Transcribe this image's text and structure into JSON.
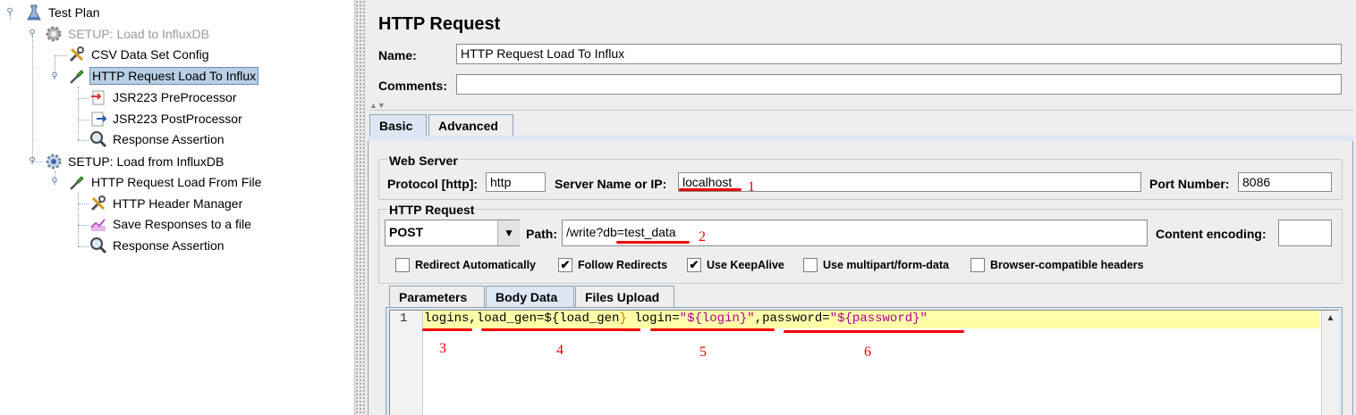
{
  "tree": {
    "items": [
      {
        "label": "Test Plan",
        "icon": "flask-icon",
        "disabled": false
      },
      {
        "label": "SETUP: Load to InfluxDB",
        "icon": "gear-icon",
        "disabled": true
      },
      {
        "label": "CSV Data Set Config",
        "icon": "wrench-icon",
        "disabled": false
      },
      {
        "label": "HTTP Request Load To Influx",
        "icon": "pipette-icon",
        "selected": true
      },
      {
        "label": "JSR223 PreProcessor",
        "icon": "preprocessor-icon"
      },
      {
        "label": "JSR223 PostProcessor",
        "icon": "postprocessor-icon"
      },
      {
        "label": "Response Assertion",
        "icon": "magnifier-icon"
      },
      {
        "label": "SETUP: Load from InfluxDB",
        "icon": "gear-icon"
      },
      {
        "label": "HTTP Request Load From File",
        "icon": "pipette-icon"
      },
      {
        "label": "HTTP Header Manager",
        "icon": "wrench-icon"
      },
      {
        "label": "Save Responses to a file",
        "icon": "chart-icon"
      },
      {
        "label": "Response Assertion",
        "icon": "magnifier-icon"
      }
    ]
  },
  "editor": {
    "title": "HTTP Request",
    "name_label": "Name:",
    "name_value": "HTTP Request Load To Influx",
    "comments_label": "Comments:",
    "comments_value": "",
    "tabs": [
      "Basic",
      "Advanced"
    ],
    "web_server": {
      "legend": "Web Server",
      "protocol_label": "Protocol [http]:",
      "protocol_value": "http",
      "server_label": "Server Name or IP:",
      "server_value": "localhost",
      "port_label": "Port Number:",
      "port_value": "8086"
    },
    "http_request": {
      "legend": "HTTP Request",
      "method": "POST",
      "path_label": "Path:",
      "path_value": "/write?db=test_data",
      "encoding_label": "Content encoding:",
      "encoding_value": ""
    },
    "checkboxes": [
      {
        "label": "Redirect Automatically",
        "checked": false
      },
      {
        "label": "Follow Redirects",
        "checked": true
      },
      {
        "label": "Use KeepAlive",
        "checked": true
      },
      {
        "label": "Use multipart/form-data",
        "checked": false
      },
      {
        "label": "Browser-compatible headers",
        "checked": false
      }
    ],
    "sub_tabs": [
      "Parameters",
      "Body Data",
      "Files Upload"
    ],
    "body": {
      "line_number": "1",
      "segments": [
        {
          "text": "logins,load_gen=",
          "color": "#000000"
        },
        {
          "text": "${",
          "color": "#000000"
        },
        {
          "text": "load_gen",
          "color": "#000000"
        },
        {
          "text": "}",
          "color": "#cc7a00"
        },
        {
          "text": " login=",
          "color": "#000000"
        },
        {
          "text": "\"${login}\"",
          "color": "#b0008c"
        },
        {
          "text": ",password=",
          "color": "#000000"
        },
        {
          "text": "\"${password}\"",
          "color": "#b0008c"
        }
      ]
    },
    "annotations": [
      "1",
      "2",
      "3",
      "4",
      "5",
      "6"
    ]
  }
}
